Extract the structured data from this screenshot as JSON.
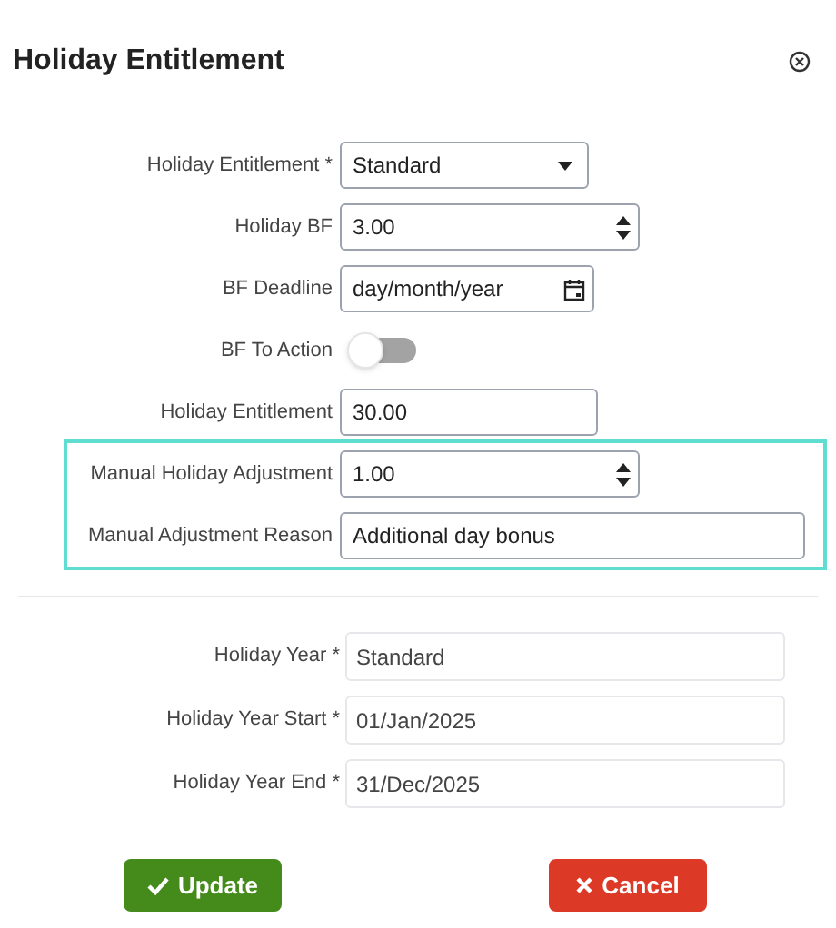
{
  "title": "Holiday Entitlement",
  "fields": [
    {
      "kind": "select",
      "label": "Holiday Entitlement *",
      "value": "Standard"
    },
    {
      "kind": "number",
      "label": "Holiday BF",
      "value": "3.00"
    },
    {
      "kind": "date",
      "label": "BF Deadline",
      "value": "day/month/year"
    },
    {
      "kind": "toggle",
      "label": "BF To Action",
      "on": false
    },
    {
      "kind": "text",
      "label": "Holiday Entitlement",
      "value": "30.00"
    }
  ],
  "highlighted_fields": [
    {
      "kind": "number",
      "label": "Manual Holiday Adjustment",
      "value": "1.00"
    },
    {
      "kind": "text",
      "label": "Manual Adjustment Reason",
      "value": "Additional day bonus"
    }
  ],
  "holiday_year": [
    {
      "label": "Holiday Year *",
      "value": "Standard"
    },
    {
      "label": "Holiday Year Start *",
      "value": "01/Jan/2025"
    },
    {
      "label": "Holiday Year End *",
      "value": "31/Dec/2025"
    }
  ],
  "buttons": [
    {
      "kind": "update",
      "label": "Update"
    },
    {
      "kind": "cancel",
      "label": "Cancel"
    }
  ]
}
